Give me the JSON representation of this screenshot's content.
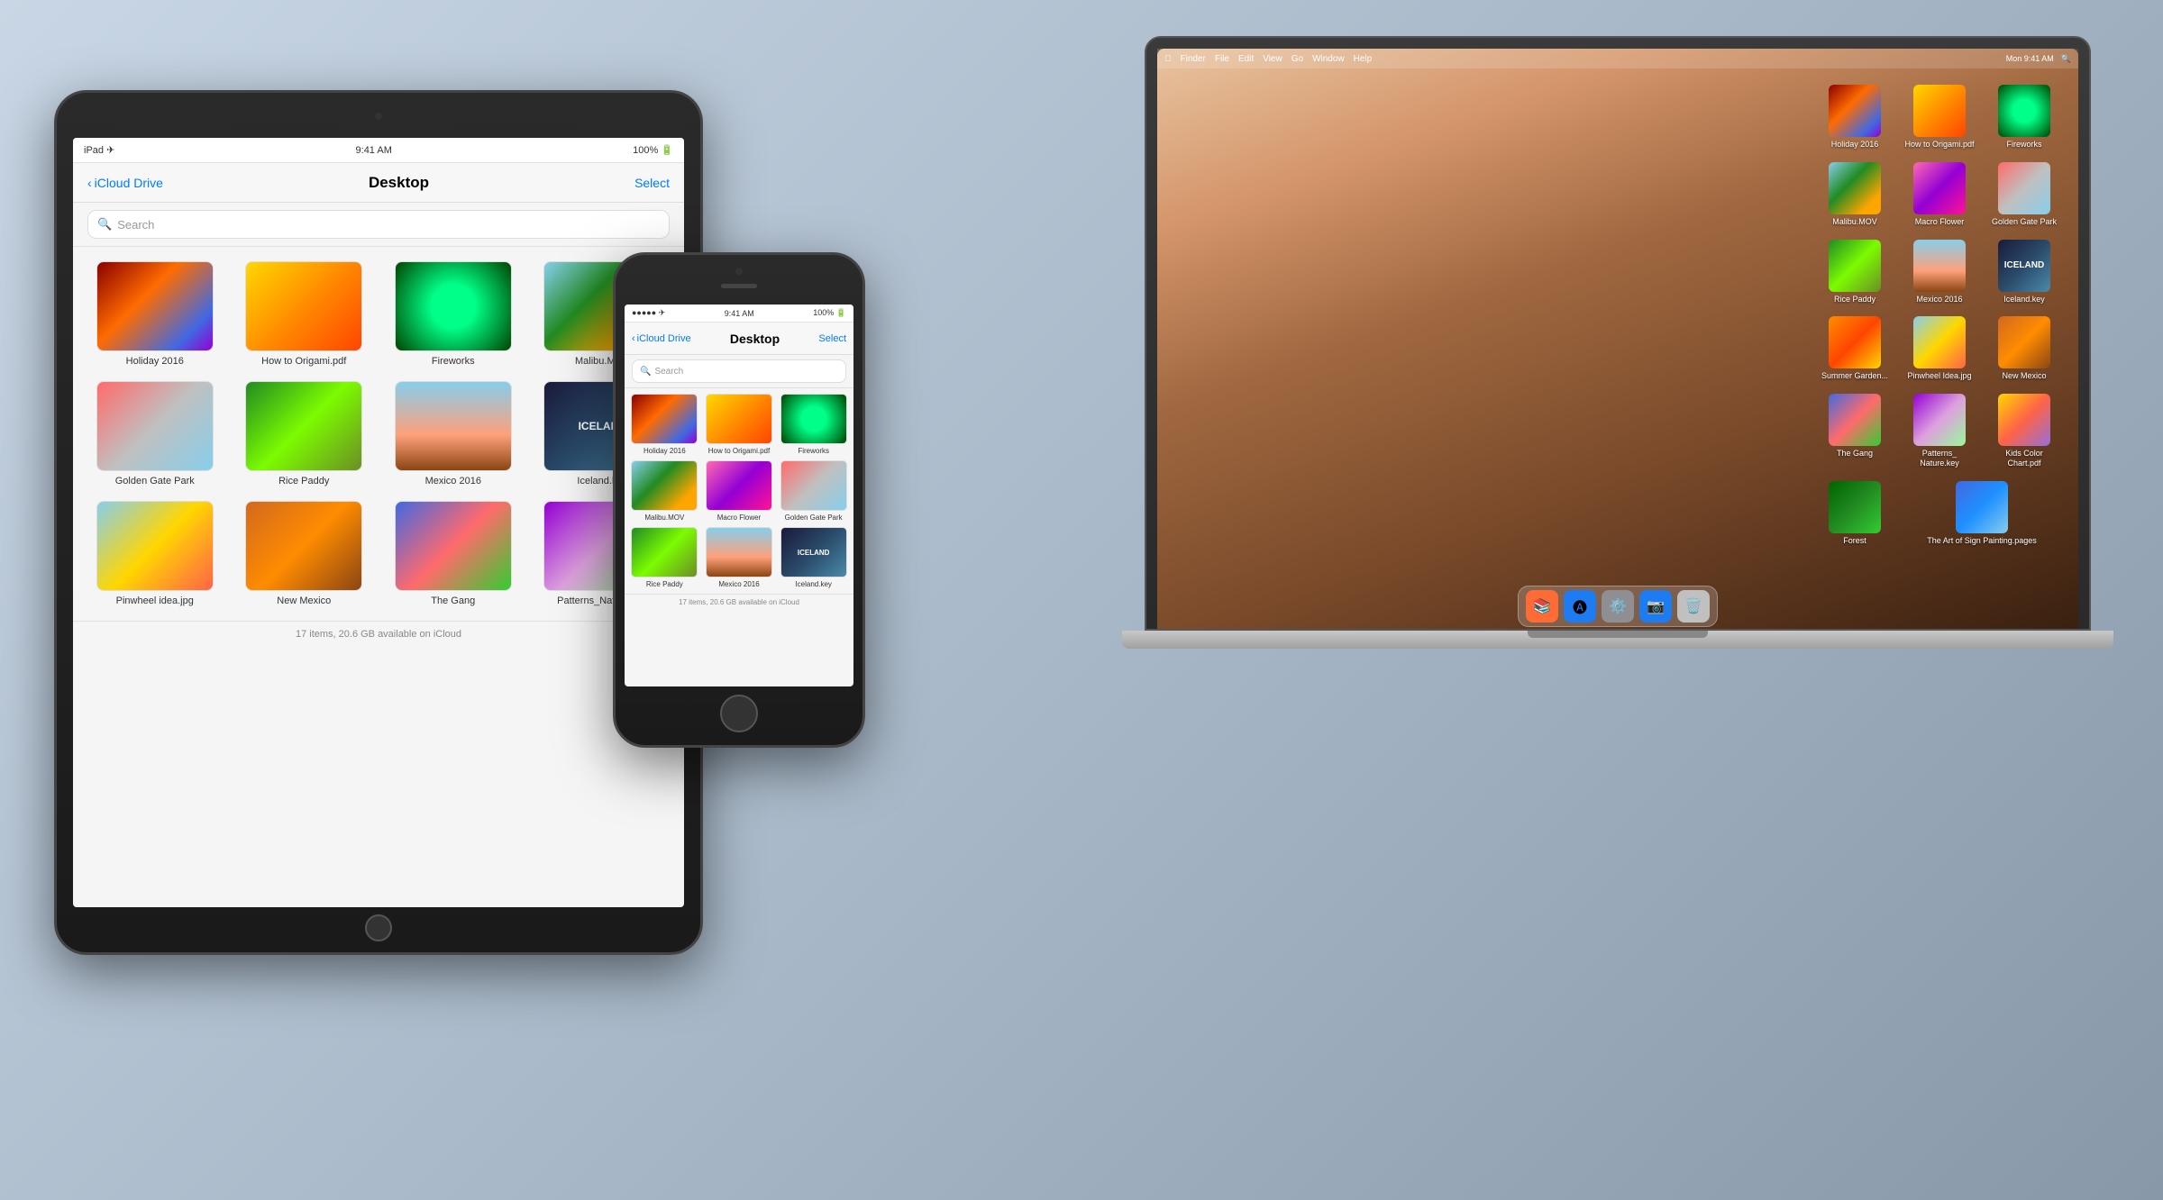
{
  "macbook": {
    "menubar": {
      "finder": "Finder",
      "file": "File",
      "edit": "Edit",
      "view": "View",
      "go": "Go",
      "window": "Window",
      "help": "Help",
      "time": "Mon 9:41 AM"
    },
    "desktop_icons": [
      {
        "id": "holiday2016",
        "label": "Holiday\n2016",
        "thumb_class": "thumb-holiday"
      },
      {
        "id": "how-to-origami",
        "label": "How to\nOrigami.pdf",
        "thumb_class": "thumb-origami"
      },
      {
        "id": "fireworks",
        "label": "Fireworks",
        "thumb_class": "thumb-fireworks"
      },
      {
        "id": "malibu-mov",
        "label": "Malibu.MOV",
        "thumb_class": "thumb-malibu"
      },
      {
        "id": "macro-flower",
        "label": "Macro Flower",
        "thumb_class": "thumb-macro-flower"
      },
      {
        "id": "golden-gate-park",
        "label": "Golden Gate\nPark",
        "thumb_class": "thumb-golden-gate"
      },
      {
        "id": "rice-paddy",
        "label": "Rice Paddy",
        "thumb_class": "thumb-rice-paddy"
      },
      {
        "id": "mexico-2016",
        "label": "Mexico 2016",
        "thumb_class": "thumb-mexico"
      },
      {
        "id": "iceland-key",
        "label": "Iceland.key",
        "thumb_class": "thumb-iceland"
      },
      {
        "id": "summer-garden",
        "label": "Summer\nGarden...",
        "thumb_class": "thumb-summer-garden"
      },
      {
        "id": "pinwheel-idea",
        "label": "Pinwheel\nIdea.jpg",
        "thumb_class": "thumb-pinwheel"
      },
      {
        "id": "new-mexico-desktop",
        "label": "New Mexico",
        "thumb_class": "thumb-new-mexico"
      },
      {
        "id": "the-gang-desktop",
        "label": "The Gang",
        "thumb_class": "thumb-gang"
      },
      {
        "id": "patterns-nature",
        "label": "Patterns_\nNature.key",
        "thumb_class": "thumb-patterns-nature"
      },
      {
        "id": "kids-color-chart",
        "label": "Kids Color\nChart.pdf",
        "thumb_class": "thumb-kids-color"
      },
      {
        "id": "forest",
        "label": "Forest",
        "thumb_class": "thumb-forest"
      },
      {
        "id": "art-of-sign",
        "label": "The Art of Sign\nPainting.pages",
        "thumb_class": "thumb-art-of-sign"
      }
    ]
  },
  "ipad": {
    "status": {
      "left": "iPad ✈",
      "center": "9:41 AM",
      "right": "100% 🔋"
    },
    "navbar": {
      "back": "iCloud Drive",
      "title": "Desktop",
      "select": "Select"
    },
    "search_placeholder": "Search",
    "items": [
      {
        "id": "holiday2016",
        "name": "Holiday 2016",
        "thumb_class": "thumb-holiday"
      },
      {
        "id": "how-origami",
        "name": "How to Origami.pdf",
        "thumb_class": "thumb-origami"
      },
      {
        "id": "fireworks",
        "name": "Fireworks",
        "thumb_class": "thumb-fireworks"
      },
      {
        "id": "malibu",
        "name": "Malibu.MOV",
        "thumb_class": "thumb-malibu"
      },
      {
        "id": "golden-gate",
        "name": "Golden Gate Park",
        "thumb_class": "thumb-golden-gate"
      },
      {
        "id": "rice-paddy",
        "name": "Rice Paddy",
        "thumb_class": "thumb-rice-paddy"
      },
      {
        "id": "mexico",
        "name": "Mexico 2016",
        "thumb_class": "thumb-mexico"
      },
      {
        "id": "iceland",
        "name": "Iceland.key",
        "thumb_class": "thumb-iceland"
      },
      {
        "id": "pinwheel",
        "name": "Pinwheel idea.jpg",
        "thumb_class": "thumb-pinwheel"
      },
      {
        "id": "new-mexico",
        "name": "New Mexico",
        "thumb_class": "thumb-new-mexico"
      },
      {
        "id": "gang",
        "name": "The Gang",
        "thumb_class": "thumb-gang"
      },
      {
        "id": "patterns",
        "name": "Patterns_Nature.key",
        "thumb_class": "thumb-patterns-nature"
      }
    ],
    "footer": "17 items, 20.6 GB available on iCloud"
  },
  "iphone": {
    "status": {
      "left": "●●●●● ✈",
      "center": "9:41 AM",
      "right": "100% 🔋"
    },
    "navbar": {
      "back": "iCloud Drive",
      "title": "Desktop",
      "select": "Select"
    },
    "search_placeholder": "Search",
    "items": [
      {
        "id": "holiday2016",
        "name": "Holiday\n2016",
        "thumb_class": "thumb-holiday"
      },
      {
        "id": "how-origami",
        "name": "How to\nOrigami.pdf",
        "thumb_class": "thumb-origami"
      },
      {
        "id": "fireworks",
        "name": "Fireworks",
        "thumb_class": "thumb-fireworks"
      },
      {
        "id": "malibu",
        "name": "Malibu.MOV",
        "thumb_class": "thumb-malibu"
      },
      {
        "id": "macro-flower",
        "name": "Macro Flower",
        "thumb_class": "thumb-macro-flower"
      },
      {
        "id": "golden-gate",
        "name": "Golden Gate\nPark",
        "thumb_class": "thumb-golden-gate"
      },
      {
        "id": "rice-paddy",
        "name": "Rice Paddy",
        "thumb_class": "thumb-rice-paddy"
      },
      {
        "id": "mexico",
        "name": "Mexico 2016",
        "thumb_class": "thumb-mexico"
      },
      {
        "id": "iceland",
        "name": "Iceland.key",
        "thumb_class": "thumb-iceland"
      }
    ],
    "footer": "17 items, 20.6 GB available on iCloud"
  }
}
